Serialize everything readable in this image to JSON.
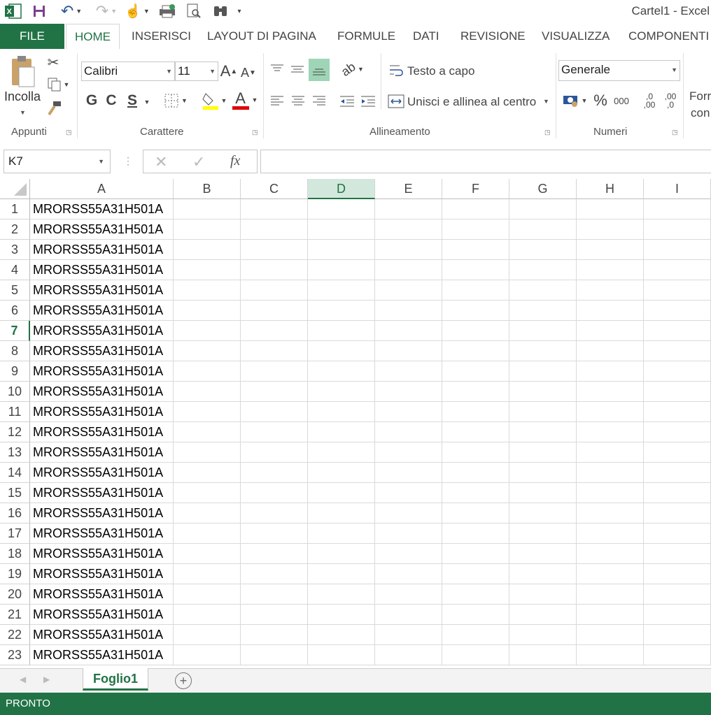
{
  "app": {
    "title": "Cartel1 - Excel",
    "accent": "#217346"
  },
  "qat": {
    "icons": [
      "excel-logo-icon",
      "save-icon",
      "undo-icon",
      "redo-icon",
      "touch-mode-icon",
      "print-icon",
      "print-preview-icon",
      "binoculars-icon",
      "customize-qat-icon"
    ]
  },
  "tabs": [
    {
      "label": "FILE"
    },
    {
      "label": "HOME"
    },
    {
      "label": "INSERISCI"
    },
    {
      "label": "LAYOUT DI PAGINA"
    },
    {
      "label": "FORMULE"
    },
    {
      "label": "DATI"
    },
    {
      "label": "REVISIONE"
    },
    {
      "label": "VISUALIZZA"
    },
    {
      "label": "COMPONENTI"
    }
  ],
  "ribbon": {
    "clipboard": {
      "paste_label": "Incolla",
      "group_label": "Appunti"
    },
    "font": {
      "name": "Calibri",
      "size": "11",
      "bold": "G",
      "italic": "C",
      "underline": "S",
      "grow": "A",
      "shrink": "A",
      "font_color": "A",
      "group_label": "Carattere"
    },
    "alignment": {
      "wrap_label": "Testo a capo",
      "merge_label": "Unisci e allinea al centro",
      "group_label": "Allineamento"
    },
    "number": {
      "format": "Generale",
      "percent": "%",
      "thousands": "000",
      "inc_dec": ",0",
      "dec_dec": ",00",
      "group_label": "Numeri"
    },
    "cutoff_label_1": "Forr",
    "cutoff_label_2": "con"
  },
  "formula_bar": {
    "name_box": "K7",
    "fx": "fx",
    "value": ""
  },
  "grid": {
    "columns": [
      "A",
      "B",
      "C",
      "D",
      "E",
      "F",
      "G",
      "H",
      "I"
    ],
    "selected_column": "D",
    "selected_row": 7,
    "rows": [
      "1",
      "2",
      "3",
      "4",
      "5",
      "6",
      "7",
      "8",
      "9",
      "10",
      "11",
      "12",
      "13",
      "14",
      "15",
      "16",
      "17",
      "18",
      "19",
      "20",
      "21",
      "22",
      "23"
    ],
    "column_a_values": [
      "MRORSS55A31H501A",
      "MRORSS55A31H501A",
      "MRORSS55A31H501A",
      "MRORSS55A31H501A",
      "MRORSS55A31H501A",
      "MRORSS55A31H501A",
      "MRORSS55A31H501A",
      "MRORSS55A31H501A",
      "MRORSS55A31H501A",
      "MRORSS55A31H501A",
      "MRORSS55A31H501A",
      "MRORSS55A31H501A",
      "MRORSS55A31H501A",
      "MRORSS55A31H501A",
      "MRORSS55A31H501A",
      "MRORSS55A31H501A",
      "MRORSS55A31H501A",
      "MRORSS55A31H501A",
      "MRORSS55A31H501A",
      "MRORSS55A31H501A",
      "MRORSS55A31H501A",
      "MRORSS55A31H501A",
      "MRORSS55A31H501A"
    ]
  },
  "sheets": [
    {
      "label": "Foglio1"
    }
  ],
  "status": {
    "text": "PRONTO"
  }
}
